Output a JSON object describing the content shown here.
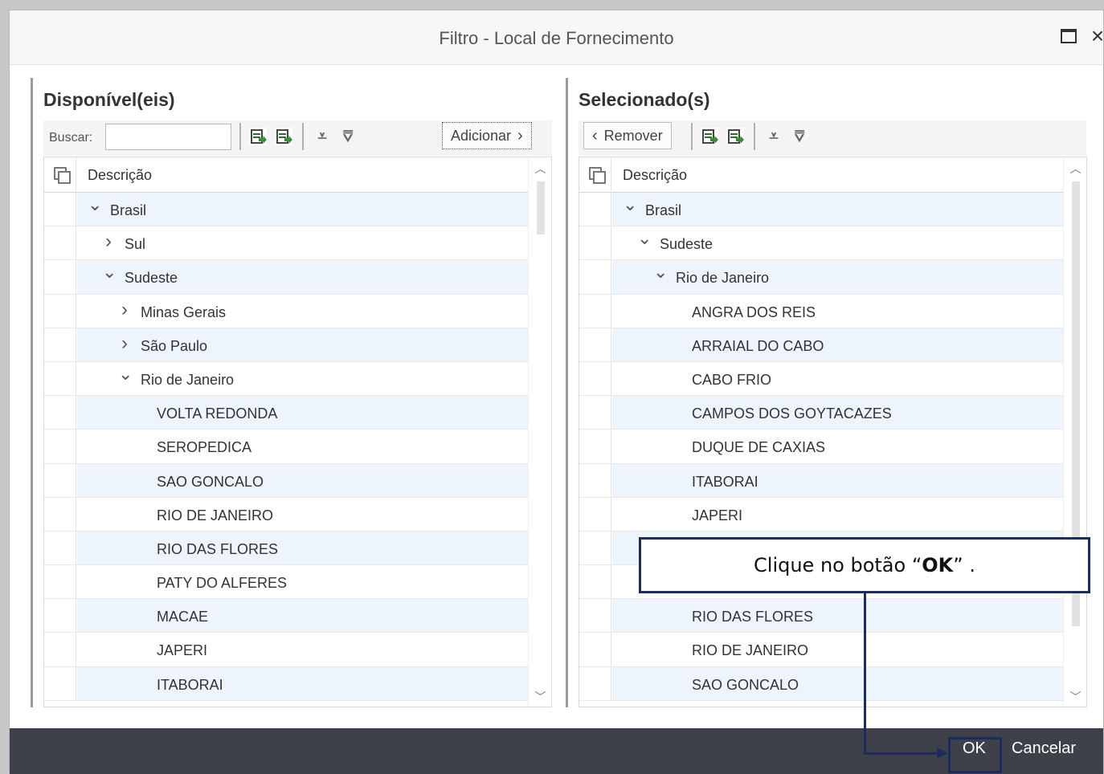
{
  "dialog": {
    "title": "Filtro - Local de Fornecimento",
    "maximize_icon": "maximize-icon",
    "close_glyph": "×"
  },
  "available": {
    "title": "Disponível(eis)",
    "search_label": "Buscar:",
    "search_value": "",
    "add_button": "Adicionar",
    "column_header": "Descrição",
    "rows": [
      {
        "label": "Brasil",
        "level": 0,
        "expander": "down"
      },
      {
        "label": "Sul",
        "level": 1,
        "expander": "right"
      },
      {
        "label": "Sudeste",
        "level": 1,
        "expander": "down"
      },
      {
        "label": "Minas Gerais",
        "level": 2,
        "expander": "right"
      },
      {
        "label": "São Paulo",
        "level": 2,
        "expander": "right"
      },
      {
        "label": "Rio de Janeiro",
        "level": 2,
        "expander": "down"
      },
      {
        "label": "VOLTA REDONDA",
        "level": 3,
        "expander": ""
      },
      {
        "label": "SEROPEDICA",
        "level": 3,
        "expander": ""
      },
      {
        "label": "SAO GONCALO",
        "level": 3,
        "expander": ""
      },
      {
        "label": "RIO DE JANEIRO",
        "level": 3,
        "expander": ""
      },
      {
        "label": "RIO DAS FLORES",
        "level": 3,
        "expander": ""
      },
      {
        "label": "PATY DO ALFERES",
        "level": 3,
        "expander": ""
      },
      {
        "label": "MACAE",
        "level": 3,
        "expander": ""
      },
      {
        "label": "JAPERI",
        "level": 3,
        "expander": ""
      },
      {
        "label": "ITABORAI",
        "level": 3,
        "expander": ""
      }
    ]
  },
  "selected": {
    "title": "Selecionado(s)",
    "remove_button": "Remover",
    "column_header": "Descrição",
    "rows": [
      {
        "label": "Brasil",
        "level": 0,
        "expander": "down"
      },
      {
        "label": "Sudeste",
        "level": 1,
        "expander": "down"
      },
      {
        "label": "Rio de Janeiro",
        "level": 2,
        "expander": "down"
      },
      {
        "label": "ANGRA DOS REIS",
        "level": 3,
        "expander": ""
      },
      {
        "label": "ARRAIAL DO CABO",
        "level": 3,
        "expander": ""
      },
      {
        "label": "CABO FRIO",
        "level": 3,
        "expander": ""
      },
      {
        "label": "CAMPOS DOS GOYTACAZES",
        "level": 3,
        "expander": ""
      },
      {
        "label": "DUQUE DE CAXIAS",
        "level": 3,
        "expander": ""
      },
      {
        "label": "ITABORAI",
        "level": 3,
        "expander": ""
      },
      {
        "label": "JAPERI",
        "level": 3,
        "expander": ""
      },
      {
        "label": "",
        "level": 3,
        "expander": ""
      },
      {
        "label": "",
        "level": 3,
        "expander": ""
      },
      {
        "label": "RIO DAS FLORES",
        "level": 3,
        "expander": ""
      },
      {
        "label": "RIO DE JANEIRO",
        "level": 3,
        "expander": ""
      },
      {
        "label": "SAO GONCALO",
        "level": 3,
        "expander": ""
      }
    ]
  },
  "footer": {
    "ok": "OK",
    "cancel": "Cancelar"
  },
  "callout": {
    "prefix": "Clique no botão “",
    "bold": "OK",
    "suffix": "” ."
  },
  "colors": {
    "footer_bg": "#3e4149",
    "row_alt": "#eef4fb",
    "callout_border": "#1d2c5a"
  }
}
